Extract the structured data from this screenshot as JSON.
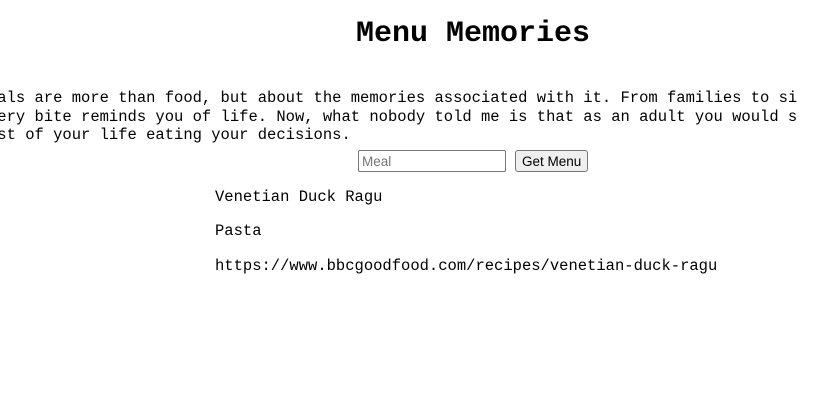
{
  "page": {
    "title": "Menu Memories",
    "intro_lines": [
      "eals are more than food, but about the memories associated with it. From families to si",
      "very bite reminds you of life. Now, what nobody told me is that as an adult you would s",
      "est of your life eating your decisions."
    ]
  },
  "form": {
    "meal_placeholder": "Meal",
    "meal_value": "",
    "submit_label": "Get Menu"
  },
  "result": {
    "meal_name": "Venetian Duck Ragu",
    "category": "Pasta",
    "source_url": "https://www.bbcgoodfood.com/recipes/venetian-duck-ragu"
  }
}
